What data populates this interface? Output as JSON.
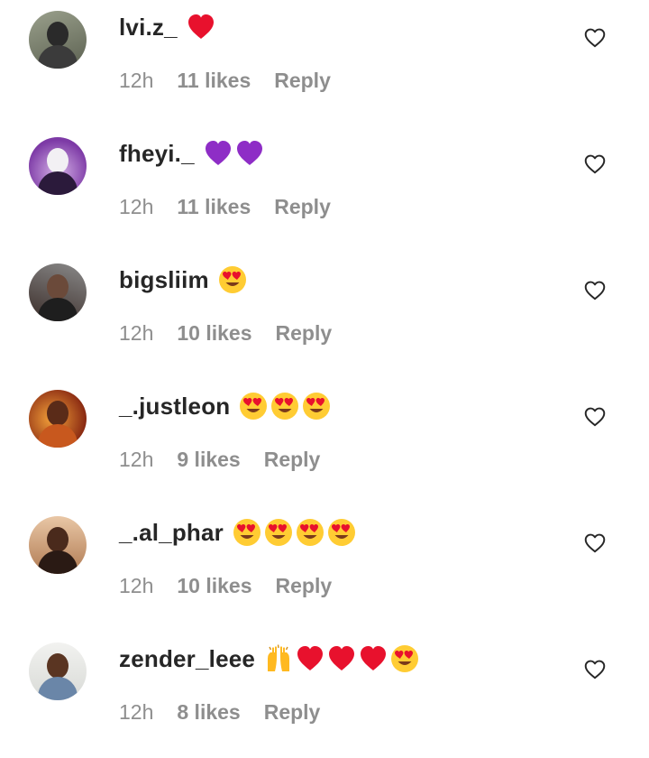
{
  "accent": {
    "text_primary": "#262626",
    "text_secondary": "#8e8e8e",
    "heart_red": "#e8112d",
    "heart_purple": "#8e2dc6"
  },
  "comments": [
    {
      "username": "lvi.z_",
      "time": "12h",
      "likes": "11 likes",
      "reply": "Reply",
      "emojis": [
        "red-heart"
      ]
    },
    {
      "username": "fheyi._",
      "time": "12h",
      "likes": "11 likes",
      "reply": "Reply",
      "emojis": [
        "purple-heart",
        "purple-heart"
      ]
    },
    {
      "username": "bigsliim",
      "time": "12h",
      "likes": "10 likes",
      "reply": "Reply",
      "emojis": [
        "heart-eyes"
      ]
    },
    {
      "username": "_.justleon",
      "time": "12h",
      "likes": "9 likes",
      "reply": "Reply",
      "emojis": [
        "heart-eyes",
        "heart-eyes",
        "heart-eyes"
      ]
    },
    {
      "username": "_.al_phar",
      "time": "12h",
      "likes": "10 likes",
      "reply": "Reply",
      "emojis": [
        "heart-eyes",
        "heart-eyes",
        "heart-eyes",
        "heart-eyes"
      ]
    },
    {
      "username": "zender_leee",
      "time": "12h",
      "likes": "8 likes",
      "reply": "Reply",
      "emojis": [
        "raised-hands",
        "red-heart",
        "red-heart",
        "red-heart",
        "heart-eyes"
      ]
    }
  ]
}
